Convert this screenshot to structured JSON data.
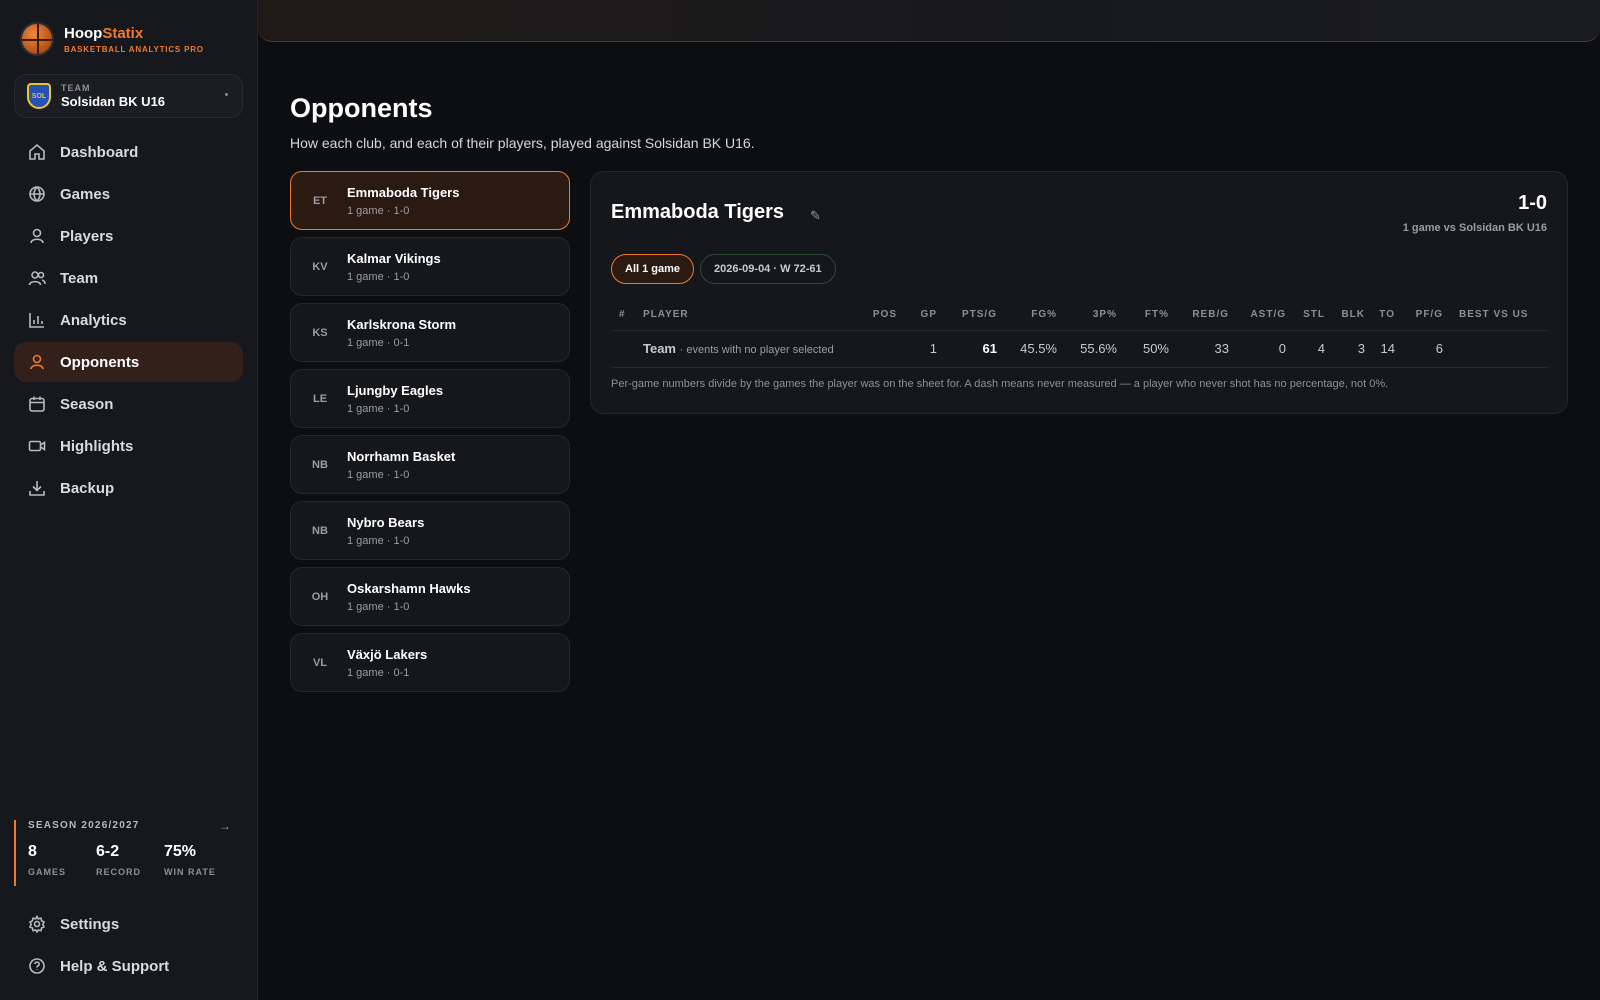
{
  "brand": {
    "name_a": "Hoop",
    "name_b": "Statix",
    "subtitle": "BASKETBALL ANALYTICS PRO"
  },
  "team_select": {
    "label": "TEAM",
    "name": "Solsidan BK U16",
    "badge": "SOL"
  },
  "nav": [
    {
      "label": "Dashboard",
      "icon": "home-icon"
    },
    {
      "label": "Games",
      "icon": "globe-icon"
    },
    {
      "label": "Players",
      "icon": "user-icon"
    },
    {
      "label": "Team",
      "icon": "users-icon"
    },
    {
      "label": "Analytics",
      "icon": "bar-chart-icon"
    },
    {
      "label": "Opponents",
      "icon": "user-icon",
      "active": true
    },
    {
      "label": "Season",
      "icon": "calendar-icon"
    },
    {
      "label": "Highlights",
      "icon": "video-icon"
    },
    {
      "label": "Backup",
      "icon": "download-icon"
    }
  ],
  "season": {
    "title": "SEASON 2026/2027",
    "stats": [
      {
        "value": "8",
        "label": "GAMES"
      },
      {
        "value": "6-2",
        "label": "RECORD"
      },
      {
        "value": "75%",
        "label": "WIN RATE"
      }
    ]
  },
  "bottom_nav": [
    {
      "label": "Settings",
      "icon": "gear-icon"
    },
    {
      "label": "Help & Support",
      "icon": "help-icon"
    }
  ],
  "page": {
    "title": "Opponents",
    "subtitle": "How each club, and each of their players, played against Solsidan BK U16."
  },
  "opponents": [
    {
      "abbr": "ET",
      "name": "Emmaboda Tigers",
      "record": "1 game · 1-0",
      "active": true
    },
    {
      "abbr": "KV",
      "name": "Kalmar Vikings",
      "record": "1 game · 1-0"
    },
    {
      "abbr": "KS",
      "name": "Karlskrona Storm",
      "record": "1 game · 0-1"
    },
    {
      "abbr": "LE",
      "name": "Ljungby Eagles",
      "record": "1 game · 1-0"
    },
    {
      "abbr": "NB",
      "name": "Norrhamn Basket",
      "record": "1 game · 1-0"
    },
    {
      "abbr": "NB",
      "name": "Nybro Bears",
      "record": "1 game · 1-0"
    },
    {
      "abbr": "OH",
      "name": "Oskarshamn Hawks",
      "record": "1 game · 1-0"
    },
    {
      "abbr": "VL",
      "name": "Växjö Lakers",
      "record": "1 game · 0-1"
    }
  ],
  "detail": {
    "title": "Emmaboda Tigers",
    "record": "1-0",
    "record_sub": "1 game vs Solsidan BK U16",
    "chips": [
      "All 1 game",
      "2026-09-04 · W 72-61"
    ],
    "columns": [
      "#",
      "PLAYER",
      "POS",
      "GP",
      "PTS/G",
      "FG%",
      "3P%",
      "FT%",
      "REB/G",
      "AST/G",
      "STL",
      "BLK",
      "TO",
      "PF/G",
      "BEST VS US"
    ],
    "row": {
      "num": "",
      "player": "Team",
      "player_note": "· events with no player selected",
      "pos": "",
      "gp": "1",
      "pts": "61",
      "fg": "45.5%",
      "tp": "55.6%",
      "ft": "50%",
      "reb": "33",
      "ast": "0",
      "stl": "4",
      "blk": "3",
      "to": "14",
      "pf": "6",
      "best": ""
    },
    "note": "Per-game numbers divide by the games the player was on the sheet for. A dash means never measured — a player who never shot has no percentage, not 0%."
  },
  "colors": {
    "accent": "#f07a2c",
    "background": "#0d0e11",
    "panel": "#15171c"
  }
}
